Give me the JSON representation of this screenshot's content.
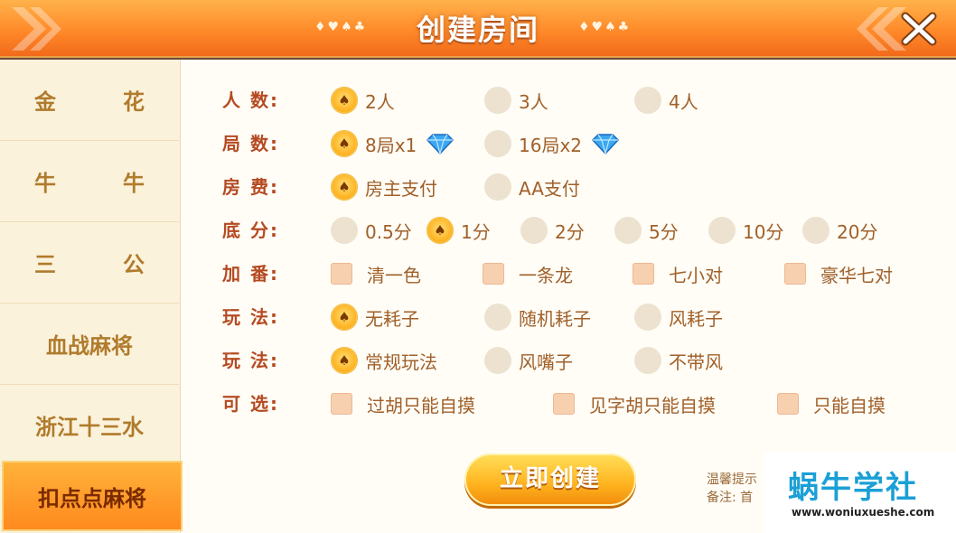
{
  "header": {
    "title": "创建房间",
    "suits": "♦♥♠♣"
  },
  "sidebar": {
    "items": [
      {
        "label": "金花"
      },
      {
        "label": "牛牛"
      },
      {
        "label": "三公"
      },
      {
        "label": "血战麻将"
      },
      {
        "label": "浙江十三水"
      },
      {
        "label": "扣点点麻将"
      }
    ]
  },
  "rows": [
    {
      "label": "人  数:",
      "options": [
        "2人",
        "3人",
        "4人"
      ]
    },
    {
      "label": "局  数:",
      "options": [
        "8局x1",
        "16局x2"
      ]
    },
    {
      "label": "房  费:",
      "options": [
        "房主支付",
        "AA支付"
      ]
    },
    {
      "label": "底  分:",
      "options": [
        "0.5分",
        "1分",
        "2分",
        "5分",
        "10分",
        "20分"
      ]
    },
    {
      "label": "加  番:",
      "options": [
        "清一色",
        "一条龙",
        "七小对",
        "豪华七对"
      ]
    },
    {
      "label": "玩  法:",
      "options": [
        "无耗子",
        "随机耗子",
        "风耗子"
      ]
    },
    {
      "label": "玩  法:",
      "options": [
        "常规玩法",
        "风嘴子",
        "不带风"
      ]
    },
    {
      "label": "可  选:",
      "options": [
        "过胡只能自摸",
        "见字胡只能自摸",
        "只能自摸"
      ]
    }
  ],
  "create_button": "立即创建",
  "tips": {
    "line1": "温馨提示",
    "line2": "备注: 首"
  },
  "watermark": {
    "title": "蜗牛学社",
    "url": "www.woniuxueshe.com"
  },
  "colors": {
    "header": "#ff8a2a",
    "active_tab": "#ff9a2a",
    "label": "#b54a22",
    "option_text": "#a0602a"
  }
}
